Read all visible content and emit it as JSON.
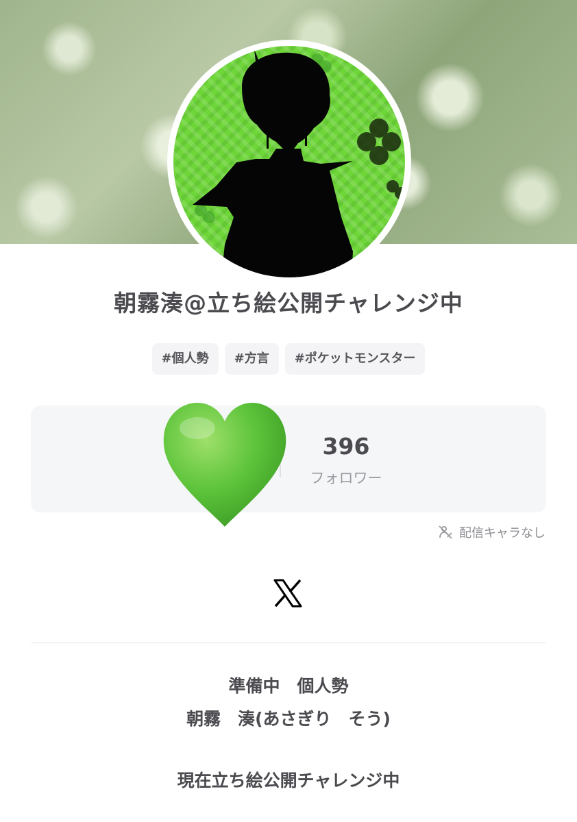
{
  "profile": {
    "display_name": "朝霧湊@立ち絵公開チャレンジ中",
    "tags": [
      "#個人勢",
      "#方言",
      "#ポケットモンスター"
    ],
    "follower_count": "396",
    "follower_label": "フォロワー",
    "streamer_status": "配信キャラなし",
    "social_link_icon": "x-logo-icon",
    "bio_lines": [
      "準備中　個人勢",
      "朝霧　湊(あさぎり　そう)",
      "現在立ち絵公開チャレンジ中"
    ]
  },
  "colors": {
    "heart": "#5cc33a",
    "avatar_bg": "#6fd63a",
    "text": "#4a4a4f",
    "muted": "#9a9aa0"
  }
}
